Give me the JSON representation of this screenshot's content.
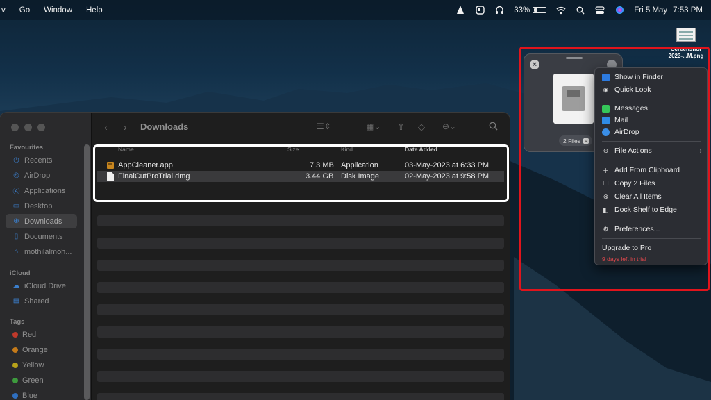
{
  "menubar": {
    "menus": [
      "v",
      "Go",
      "Window",
      "Help"
    ],
    "battery_percent": "33%",
    "battery_level": 0.33,
    "date": "Fri 5 May",
    "time": "7:53 PM",
    "icons": [
      "vlc-icon",
      "dropover-icon",
      "headphones-icon",
      "battery-icon",
      "wifi-icon",
      "search-icon",
      "control-center-icon",
      "siri-icon"
    ]
  },
  "desktop": {
    "file_name_line1": "Screenshot",
    "file_name_line2": "2023-...M.png"
  },
  "finder": {
    "title": "Downloads",
    "sidebar": {
      "favourites_label": "Favourites",
      "favourites": [
        "Recents",
        "AirDrop",
        "Applications",
        "Desktop",
        "Downloads",
        "Documents",
        "mothilalmoh..."
      ],
      "icloud_label": "iCloud",
      "icloud": [
        "iCloud Drive",
        "Shared"
      ],
      "tags_label": "Tags",
      "tags": [
        {
          "label": "Red",
          "color": "#c0392b"
        },
        {
          "label": "Orange",
          "color": "#c47a1a"
        },
        {
          "label": "Yellow",
          "color": "#b8a21a"
        },
        {
          "label": "Green",
          "color": "#3d9a3d"
        },
        {
          "label": "Blue",
          "color": "#2f6fbf"
        }
      ]
    },
    "columns": {
      "name": "Name",
      "size": "Size",
      "kind": "Kind",
      "date_added": "Date Added"
    },
    "files": [
      {
        "name": "AppCleaner.app",
        "size": "7.3 MB",
        "kind": "Application",
        "date_added": "03-May-2023 at 6:33 PM"
      },
      {
        "name": "FinalCutProTrial.dmg",
        "size": "3.44 GB",
        "kind": "Disk Image",
        "date_added": "02-May-2023 at 9:58 PM"
      }
    ]
  },
  "shelf": {
    "count_label": "2 Files",
    "menu": {
      "show_in_finder": "Show in Finder",
      "quick_look": "Quick Look",
      "messages": "Messages",
      "mail": "Mail",
      "airdrop": "AirDrop",
      "file_actions": "File Actions",
      "add_from_clipboard": "Add From Clipboard",
      "copy_files": "Copy 2 Files",
      "clear_all": "Clear All Items",
      "dock_shelf": "Dock Shelf to Edge",
      "preferences": "Preferences...",
      "upgrade": "Upgrade to Pro",
      "trial": "9 days left in trial"
    }
  }
}
